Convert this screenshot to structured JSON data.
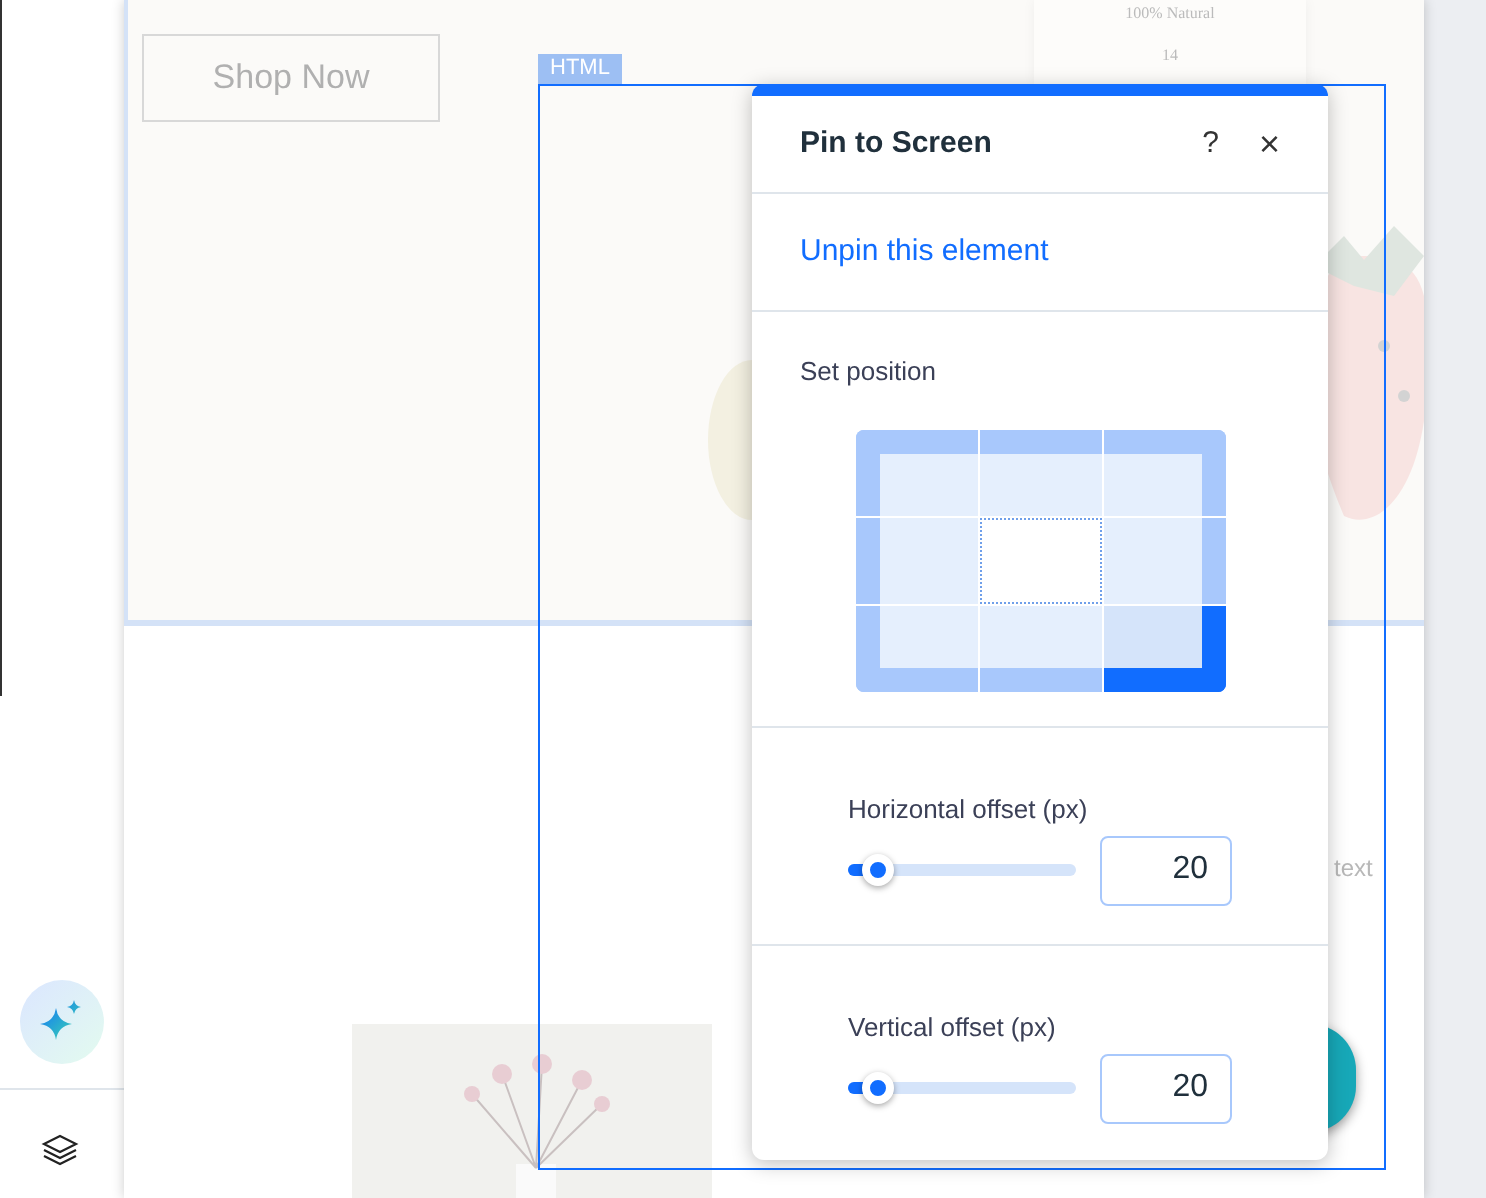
{
  "canvas": {
    "hero_button": "Shop Now",
    "product_card": {
      "label": "100% Natural",
      "number": "14"
    },
    "side_text": "text",
    "selection_label": "HTML"
  },
  "panel": {
    "title": "Pin to Screen",
    "help": "?",
    "close": "×",
    "unpin_link": "Unpin this element",
    "position_label": "Set position",
    "positions": [
      {
        "selected": false
      },
      {
        "selected": false
      },
      {
        "selected": false
      },
      {
        "selected": false
      },
      {
        "selected": false
      },
      {
        "selected": false
      },
      {
        "selected": false
      },
      {
        "selected": false
      },
      {
        "selected": true
      }
    ],
    "offsets": [
      {
        "label": "Horizontal offset (px)",
        "level": 0.13,
        "value": "20"
      },
      {
        "label": "Vertical offset (px)",
        "level": 0.13,
        "value": "20"
      }
    ]
  }
}
